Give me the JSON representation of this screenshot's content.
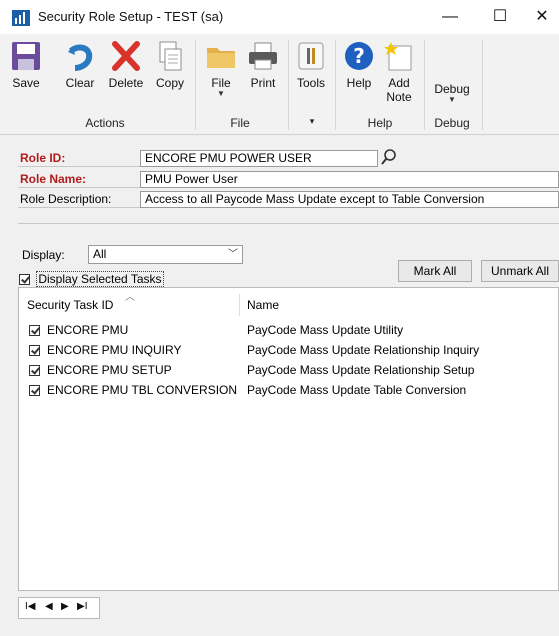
{
  "window": {
    "title": "Security Role Setup  -  TEST (sa)",
    "controls": {
      "minimize": "—",
      "maximize": "☐",
      "close": "✕"
    }
  },
  "ribbon": {
    "buttons": {
      "save": "Save",
      "clear": "Clear",
      "delete": "Delete",
      "copy": "Copy",
      "file": "File",
      "print": "Print",
      "tools": "Tools",
      "help": "Help",
      "add_note_1": "Add",
      "add_note_2": "Note",
      "debug": "Debug"
    },
    "groups": {
      "actions": "Actions",
      "file": "File",
      "tools": "▾",
      "help": "Help",
      "debug": "Debug"
    },
    "colors": {
      "save": "#6b4c9a",
      "clear": "#2a7ac2",
      "delete": "#d9342b",
      "help": "#1f5fbf"
    }
  },
  "form": {
    "role_id_label": "Role ID:",
    "role_id_value": "ENCORE PMU POWER USER",
    "role_name_label": "Role Name:",
    "role_name_value": "PMU Power User",
    "role_desc_label": "Role Description:",
    "role_desc_value": "Access to all Paycode Mass Update except to Table Conversion",
    "display_label": "Display:",
    "display_value": "All",
    "display_selected_label": "Display Selected Tasks",
    "mark_all": "Mark All",
    "unmark_all": "Unmark All"
  },
  "grid": {
    "headers": {
      "task_id": "Security Task ID",
      "name": "Name"
    },
    "rows": [
      {
        "task": "ENCORE PMU",
        "name": "PayCode Mass Update Utility",
        "checked": true
      },
      {
        "task": "ENCORE PMU INQUIRY",
        "name": "PayCode Mass Update Relationship Inquiry",
        "checked": true
      },
      {
        "task": "ENCORE PMU SETUP",
        "name": "PayCode Mass Update Relationship Setup",
        "checked": true
      },
      {
        "task": "ENCORE PMU TBL CONVERSION",
        "name": "PayCode Mass Update Table Conversion",
        "checked": true
      }
    ]
  },
  "navigation": {
    "first": "I◀",
    "prev": "◀",
    "next": "▶",
    "last": "▶I"
  }
}
